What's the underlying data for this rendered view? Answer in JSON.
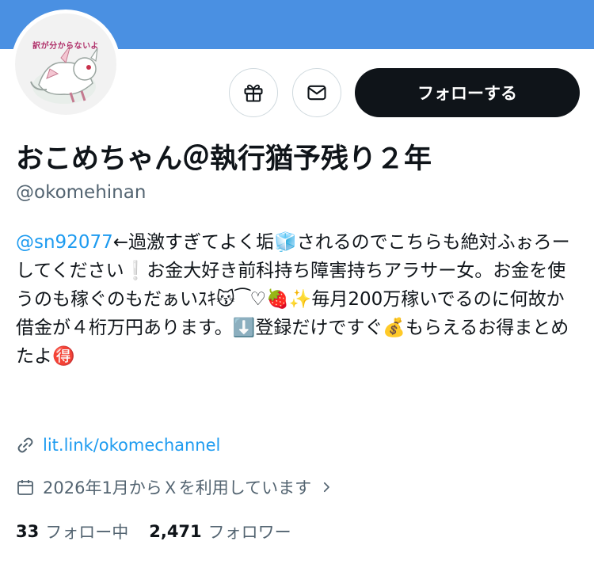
{
  "profile": {
    "avatar_text": "訳が分からないよ",
    "display_name": "おこめちゃん＠執行猶予残り２年",
    "handle": "@okomehinan",
    "follow_label": "フォローする",
    "bio": {
      "mention": "@sn92077",
      "text": "←過激すぎてよく垢🧊されるのでこちらも絶対ふぉろーしてください❕お金大好き前科持ち障害持ちアラサー女。お金を使うのも稼ぐのもだぁいｽｷ😽⁀♡🍓✨毎月200万稼いでるのに何故か借金が４桁万円あります。⬇️登録だけですぐ💰もらえるお得まとめたよ🉐"
    },
    "link": "lit.link/okomechannel",
    "joined": "2026年1月からＸを利用しています",
    "following_count": "33",
    "following_label": "フォロー中",
    "followers_count": "2,471",
    "followers_label": "フォロワー"
  },
  "icons": {
    "gift": "gift-icon",
    "mail": "mail-icon",
    "link": "link-icon",
    "calendar": "calendar-icon",
    "chevron": "chevron-right-icon"
  },
  "colors": {
    "banner": "#4a90e2",
    "accent": "#1d9bf0",
    "button_dark": "#0f1419",
    "secondary_text": "#536471"
  }
}
